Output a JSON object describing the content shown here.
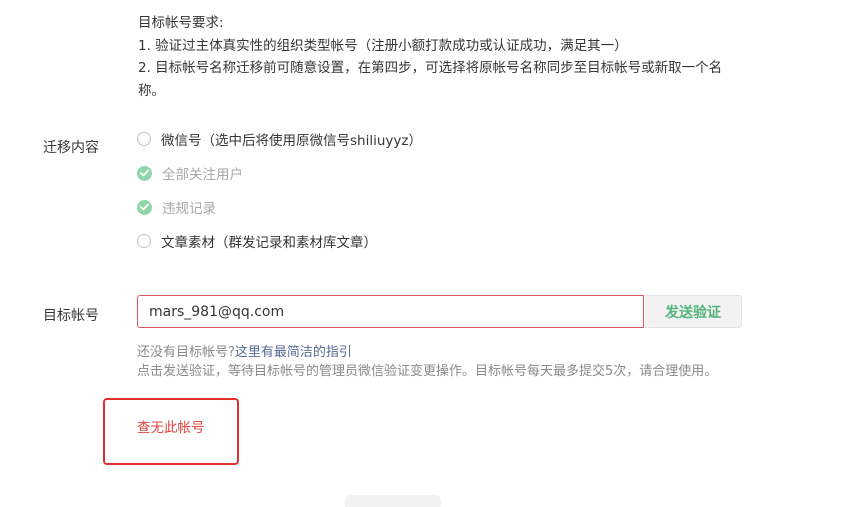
{
  "requirements": {
    "title": "目标帐号要求:",
    "line1": "1. 验证过主体真实性的组织类型帐号（注册小额打款成功或认证成功，满足其一）",
    "line2": "2. 目标帐号名称迁移前可随意设置，在第四步，可选择将原帐号名称同步至目标帐号或新取一个名称。"
  },
  "migration": {
    "label": "迁移内容",
    "options": [
      {
        "text": "微信号（选中后将使用原微信号shiliuyyz）",
        "state": "unchecked"
      },
      {
        "text": "全部关注用户",
        "state": "checked-disabled"
      },
      {
        "text": "违规记录",
        "state": "checked-disabled"
      },
      {
        "text": "文章素材（群发记录和素材库文章）",
        "state": "unchecked"
      }
    ]
  },
  "target": {
    "label": "目标帐号",
    "input_value": "mars_981@qq.com",
    "send_button": "发送验证",
    "no_account_prefix": "还没有目标帐号?",
    "guide_link": "这里有最简洁的指引",
    "note": "点击发送验证，等待目标帐号的管理员微信验证变更操作。目标帐号每天最多提交5次，请合理使用。",
    "error": "查无此帐号"
  },
  "colors": {
    "accent_green": "#52b47a",
    "error_red": "#e0453f",
    "link_blue": "#576b95"
  }
}
